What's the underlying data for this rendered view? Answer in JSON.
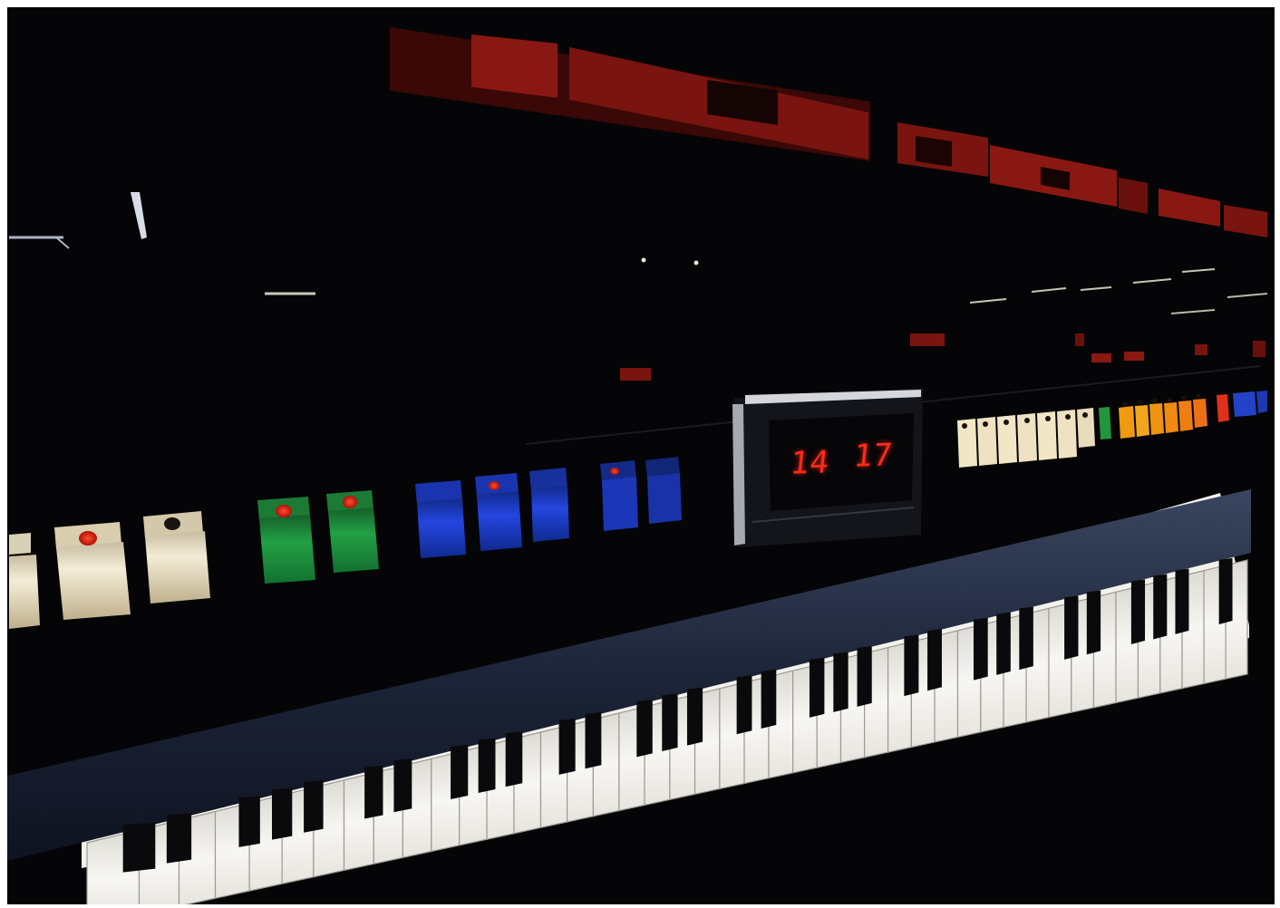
{
  "image": {
    "subject": "synthesizer-keyboard-panel"
  },
  "display": {
    "left_value": "14",
    "right_value": "17"
  },
  "colors": {
    "background": "#050507",
    "panel_dark": "#0b0b10",
    "stripe_red": "#7a1410",
    "button_cream": "#efe3c0",
    "button_green": "#1f8a3a",
    "button_blue": "#1d3fd2",
    "button_orange": "#f09a12",
    "led_red": "#ff2a1a",
    "key_white": "#f4f2ee",
    "key_black": "#0a0a0c",
    "keybed_rail": "#1c2438"
  }
}
